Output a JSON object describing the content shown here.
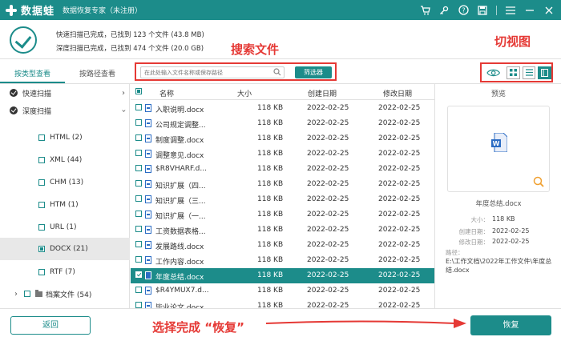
{
  "titlebar": {
    "logo_text": "数据蛙",
    "app_title": "数据恢复专家（未注册）",
    "icons": [
      "cart-icon",
      "key-icon",
      "help-icon",
      "save-icon",
      "menu-icon",
      "minimize-icon",
      "close-icon"
    ]
  },
  "summary": {
    "quick_scan": "快速扫描已完成，已找到 123 个文件 (43.8 MB)",
    "deep_scan": "深度扫描已完成，已找到 474 个文件 (20.0 GB)"
  },
  "annotations": {
    "search": "搜索文件",
    "view": "切视图",
    "recover": "选择完成 “恢复”"
  },
  "tabs": [
    {
      "label": "按类型查看",
      "active": true
    },
    {
      "label": "按路径查看",
      "active": false
    }
  ],
  "search": {
    "placeholder": "在此处输入文件名称或保存路径",
    "filter_label": "筛选器"
  },
  "sidebar": {
    "groups": [
      {
        "label": "快速扫描",
        "expanded": false
      },
      {
        "label": "深度扫描",
        "expanded": true
      }
    ],
    "items": [
      {
        "label": "HTML (2)"
      },
      {
        "label": "XML (44)"
      },
      {
        "label": "CHM (13)"
      },
      {
        "label": "HTM (1)"
      },
      {
        "label": "URL (1)"
      },
      {
        "label": "DOCX (21)",
        "selected": true
      },
      {
        "label": "RTF (7)"
      }
    ],
    "archive": {
      "label": "档案文件 (54)"
    }
  },
  "list": {
    "headers": [
      "名称",
      "大小",
      "创建日期",
      "修改日期"
    ],
    "rows": [
      {
        "name": "入职说明.docx",
        "size": "118 KB",
        "created": "2022-02-25",
        "modified": "2022-02-25"
      },
      {
        "name": "公司规定调整...",
        "size": "118 KB",
        "created": "2022-02-25",
        "modified": "2022-02-25"
      },
      {
        "name": "制度调整.docx",
        "size": "118 KB",
        "created": "2022-02-25",
        "modified": "2022-02-25"
      },
      {
        "name": "调整意见.docx",
        "size": "118 KB",
        "created": "2022-02-25",
        "modified": "2022-02-25"
      },
      {
        "name": "$R8VHARF.d...",
        "size": "118 KB",
        "created": "2022-02-25",
        "modified": "2022-02-25"
      },
      {
        "name": "知识扩展（四...",
        "size": "118 KB",
        "created": "2022-02-25",
        "modified": "2022-02-25"
      },
      {
        "name": "知识扩展（三...",
        "size": "118 KB",
        "created": "2022-02-25",
        "modified": "2022-02-25"
      },
      {
        "name": "知识扩展（一...",
        "size": "118 KB",
        "created": "2022-02-25",
        "modified": "2022-02-25"
      },
      {
        "name": "工资数据表格...",
        "size": "118 KB",
        "created": "2022-02-25",
        "modified": "2022-02-25"
      },
      {
        "name": "发展路线.docx",
        "size": "118 KB",
        "created": "2022-02-25",
        "modified": "2022-02-25"
      },
      {
        "name": "工作内容.docx",
        "size": "118 KB",
        "created": "2022-02-25",
        "modified": "2022-02-25"
      },
      {
        "name": "年度总结.docx",
        "size": "118 KB",
        "created": "2022-02-25",
        "modified": "2022-02-25",
        "selected": true
      },
      {
        "name": "$R4YMUX7.d...",
        "size": "118 KB",
        "created": "2022-02-25",
        "modified": "2022-02-25"
      },
      {
        "name": "毕业论文.docx",
        "size": "118 KB",
        "created": "2022-02-25",
        "modified": "2022-02-25"
      }
    ]
  },
  "preview": {
    "title": "预览",
    "file_name": "年度总结.docx",
    "size_label": "大小：",
    "size": "118 KB",
    "created_label": "创建日期：",
    "created": "2022-02-25",
    "modified_label": "修改日期：",
    "modified": "2022-02-25",
    "path_label": "路径：",
    "path": "E:\\工作文档\\2022年工作文件\\年度总结.docx"
  },
  "footer": {
    "back_label": "返回",
    "recover_label": "恢复"
  },
  "colors": {
    "accent": "#1c8c8a",
    "annotation": "#e53935"
  }
}
